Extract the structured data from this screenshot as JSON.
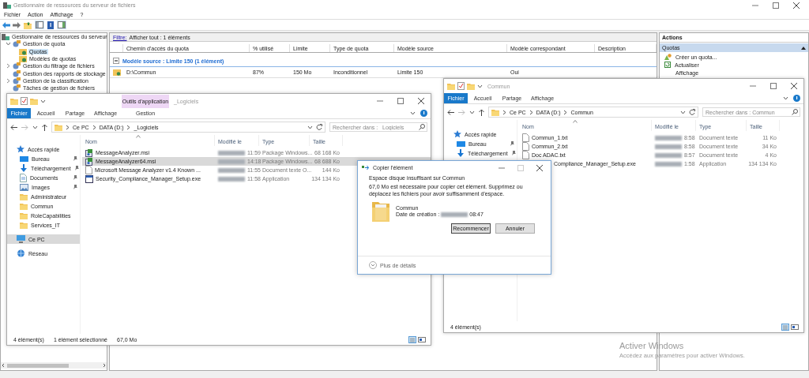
{
  "window": {
    "title": "Gestionnaire de ressources du serveur de fichiers"
  },
  "menu": [
    "Fichier",
    "Action",
    "Affichage",
    "?"
  ],
  "tree": [
    {
      "label": "Gestionnaire de ressources du serveur",
      "selected": false,
      "children": [
        {
          "label": "Gestion de quota",
          "expanded": true,
          "selected": false,
          "children": [
            {
              "label": "Quotas",
              "selected": true
            },
            {
              "label": "Modèles de quotas",
              "selected": false
            }
          ]
        },
        {
          "label": "Gestion du filtrage de fichiers",
          "expanded": false,
          "selected": false
        },
        {
          "label": "Gestion des rapports de stockage",
          "selected": false
        },
        {
          "label": "Gestion de la classification",
          "expanded": false,
          "selected": false
        },
        {
          "label": "Tâches de gestion de fichiers",
          "selected": false
        }
      ]
    }
  ],
  "filter_bar": {
    "link": "Filtre:",
    "text": "Afficher tout : 1 éléments"
  },
  "table": {
    "columns": [
      "Chemin d'accès du quota",
      "% utilisé",
      "Limite",
      "Type de quota",
      "Modèle source",
      "Modèle correspondant",
      "Description"
    ],
    "group": {
      "label": "Modèle source : Limite 150 (1 élément)",
      "expanded": true
    },
    "rows": [
      {
        "path": "D:\\Commun",
        "used": "87%",
        "limit": "150 Mo",
        "type": "Inconditionnel",
        "source_template": "Limite 150",
        "matching_template": "Oui"
      }
    ]
  },
  "actions": {
    "title": "Actions",
    "section": {
      "label": "Quotas",
      "expanded": true
    },
    "items": [
      "Créer un quota...",
      "Actualiser",
      "Affichage"
    ]
  },
  "explorers": [
    {
      "title": "_Logiciels",
      "context_label": "Outils d'application",
      "ribbon_tabs": [
        {
          "label": "Fichier",
          "selected": true
        },
        {
          "label": "Accueil",
          "selected": false
        },
        {
          "label": "Partage",
          "selected": false
        },
        {
          "label": "Affichage",
          "selected": false
        },
        {
          "label": "Gestion",
          "selected": false
        }
      ],
      "path": [
        "Ce PC",
        "DATA (D:)",
        "_Logiciels"
      ],
      "search_placeholder": "Rechercher dans : _Logiciels",
      "nav": [
        {
          "label": "Accès rapide",
          "kind": "star",
          "selected": false
        },
        {
          "label": "Bureau",
          "kind": "desktop",
          "pinned": true,
          "selected": false
        },
        {
          "label": "Téléchargement",
          "kind": "download",
          "pinned": true,
          "selected": false
        },
        {
          "label": "Documents",
          "kind": "document",
          "pinned": true,
          "selected": false
        },
        {
          "label": "Images",
          "kind": "pictures",
          "pinned": true,
          "selected": false
        },
        {
          "label": "Administrateur",
          "kind": "folder",
          "selected": false
        },
        {
          "label": "Commun",
          "kind": "folder",
          "selected": false
        },
        {
          "label": "RoleCapabilities",
          "kind": "folder",
          "selected": false
        },
        {
          "label": "Services_IT",
          "kind": "folder",
          "selected": false
        },
        {
          "label": "Ce PC",
          "kind": "pc",
          "selected": true
        },
        {
          "label": "Réseau",
          "kind": "network",
          "selected": false
        }
      ],
      "columns": [
        "Nom",
        "Modifié le",
        "Type",
        "Taille"
      ],
      "files": [
        {
          "name": "MessageAnalyzer.msi",
          "kind": "installer",
          "time": "11:59",
          "type": "Package Windows...",
          "size": "68 168 Ko",
          "selected": false
        },
        {
          "name": "MessageAnalyzer64.msi",
          "kind": "installer",
          "time": "14:18",
          "type": "Package Windows...",
          "size": "68 688 Ko",
          "selected": true
        },
        {
          "name": "Microsoft Message Analyzer v1.4 Known ...",
          "kind": "text",
          "time": "11:55",
          "type": "Document texte O...",
          "size": "144 Ko",
          "selected": false
        },
        {
          "name": "Security_Compliance_Manager_Setup.exe",
          "kind": "application",
          "time": "11:58",
          "type": "Application",
          "size": "134 134 Ko",
          "selected": false
        }
      ],
      "status": [
        "4 élément(s)",
        "1 élément sélectionné",
        "67,0 Mo"
      ]
    },
    {
      "title": "Commun",
      "ribbon_tabs": [
        {
          "label": "Fichier",
          "selected": true
        },
        {
          "label": "Accueil",
          "selected": false
        },
        {
          "label": "Partage",
          "selected": false
        },
        {
          "label": "Affichage",
          "selected": false
        }
      ],
      "path": [
        "Ce PC",
        "DATA (D:)",
        "Commun"
      ],
      "search_placeholder": "Rechercher dans : Commun",
      "nav": [
        {
          "label": "Accès rapide",
          "kind": "star",
          "selected": false
        },
        {
          "label": "Bureau",
          "kind": "desktop",
          "pinned": true,
          "selected": false
        },
        {
          "label": "Téléchargement",
          "kind": "download",
          "pinned": true,
          "selected": false
        }
      ],
      "columns": [
        "Nom",
        "Modifié le",
        "Type",
        "Taille"
      ],
      "files": [
        {
          "name": "Commun_1.txt",
          "kind": "text",
          "time": "8:58",
          "type": "Document texte",
          "size": "11 Ko",
          "selected": false
        },
        {
          "name": "Commun_2.txt",
          "kind": "text",
          "time": "8:58",
          "type": "Document texte",
          "size": "34 Ko",
          "selected": false
        },
        {
          "name": "Doc ADAC.txt",
          "kind": "text",
          "time": "8:57",
          "type": "Document texte",
          "size": "4 Ko",
          "selected": false
        },
        {
          "name": "Compliance_Manager_Setup.exe",
          "kind": "covered",
          "time": "1:58",
          "type": "Application",
          "size": "134 134 Ko",
          "selected": false
        }
      ],
      "status": [
        "4 élément(s)"
      ]
    }
  ],
  "dialog": {
    "title": "Copier l'élément",
    "heading": "Espace disque insuffisant sur Commun",
    "message": "67,0 Mo est nécessaire pour copier cet élément. Supprimez ou déplacez les fichiers pour avoir suffisamment d'espace.",
    "item_name": "Commun",
    "item_date_label": "Date de création :",
    "item_time": "08:47",
    "buttons": [
      "Recommencer",
      "Annuler"
    ],
    "details": "Plus de détails"
  },
  "activation_notice": {
    "title": "Activer Windows",
    "text": "Accédez aux paramètres pour activer Windows."
  }
}
